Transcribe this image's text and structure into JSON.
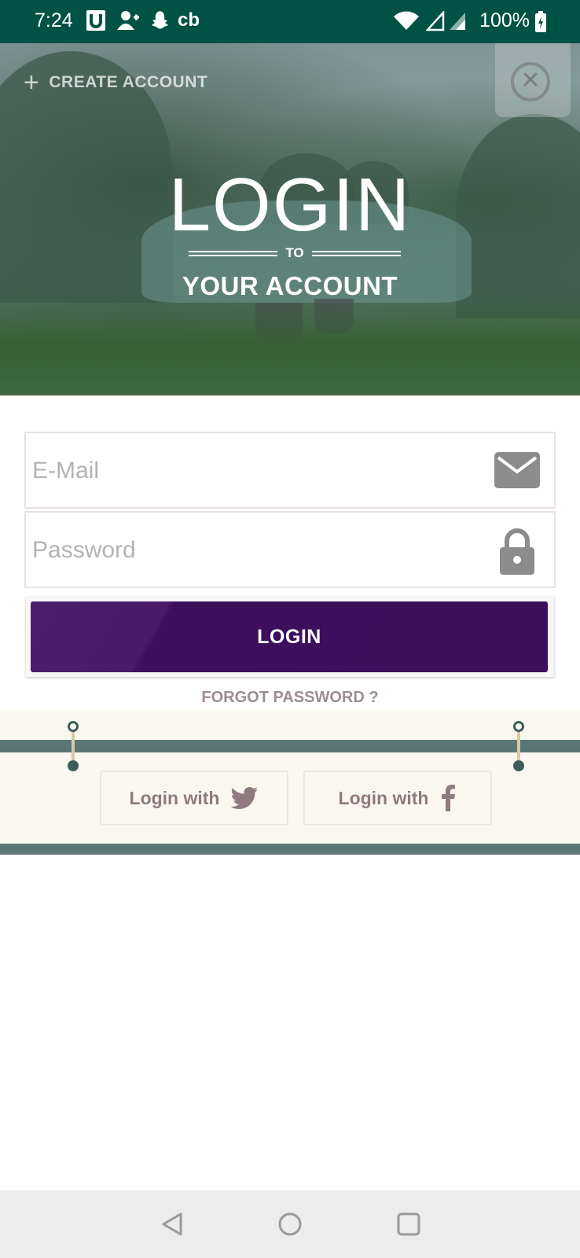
{
  "status_bar": {
    "time": "7:24",
    "notification_icons": [
      "u-icon",
      "add-user-icon",
      "snapchat-icon"
    ],
    "cb_label": "cb",
    "battery_percent": "100%",
    "bg_color": "#005244"
  },
  "hero": {
    "create_account_label": "CREATE ACCOUNT",
    "title": "LOGIN",
    "to_label": "TO",
    "subtitle": "YOUR ACCOUNT"
  },
  "form": {
    "email": {
      "placeholder": "E-Mail",
      "value": ""
    },
    "password": {
      "placeholder": "Password",
      "value": ""
    },
    "login_button": "LOGIN",
    "forgot_password": "FORGOT PASSWORD ?",
    "accent_color": "#3c0f5b"
  },
  "social": {
    "twitter_label": "Login with",
    "facebook_label": "Login with",
    "band_color": "#5b7775"
  },
  "nav_bar": {
    "buttons": [
      "back-icon",
      "home-icon",
      "recents-icon"
    ]
  }
}
